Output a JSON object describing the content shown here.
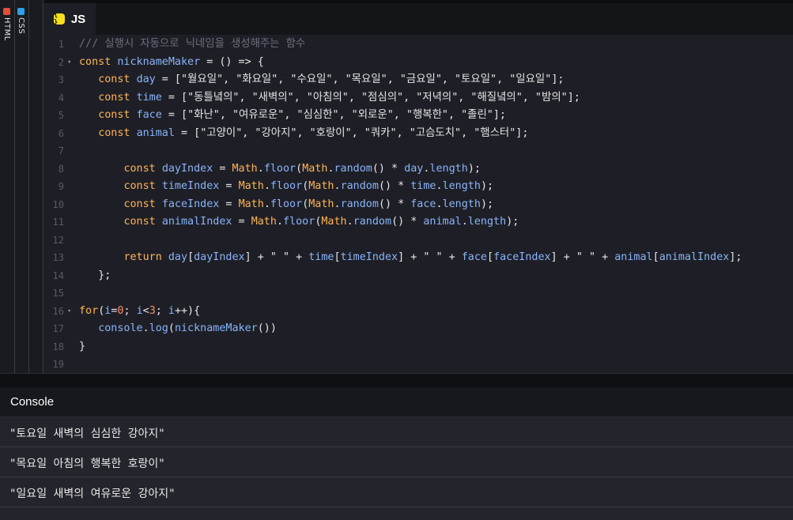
{
  "side_tabs": [
    {
      "label": "HTML",
      "icon": "html-badge-icon"
    },
    {
      "label": "CSS",
      "icon": "css-badge-icon"
    }
  ],
  "editor": {
    "active_tab": "JS",
    "lines": [
      {
        "n": "1",
        "fold": ""
      },
      {
        "n": "2",
        "fold": "▾"
      },
      {
        "n": "3",
        "fold": ""
      },
      {
        "n": "4",
        "fold": ""
      },
      {
        "n": "5",
        "fold": ""
      },
      {
        "n": "6",
        "fold": ""
      },
      {
        "n": "7",
        "fold": ""
      },
      {
        "n": "8",
        "fold": ""
      },
      {
        "n": "9",
        "fold": ""
      },
      {
        "n": "10",
        "fold": ""
      },
      {
        "n": "11",
        "fold": ""
      },
      {
        "n": "12",
        "fold": ""
      },
      {
        "n": "13",
        "fold": ""
      },
      {
        "n": "14",
        "fold": ""
      },
      {
        "n": "15",
        "fold": ""
      },
      {
        "n": "16",
        "fold": "▾"
      },
      {
        "n": "17",
        "fold": ""
      },
      {
        "n": "18",
        "fold": ""
      },
      {
        "n": "19",
        "fold": ""
      }
    ],
    "code": [
      [
        [
          "c",
          "/// 실행시 자동으로 닉네임을 생성해주는 함수"
        ]
      ],
      [
        [
          "k",
          "const "
        ],
        [
          "v",
          "nicknameMaker"
        ],
        [
          "p",
          " = () => {"
        ]
      ],
      [
        [
          "p",
          "   "
        ],
        [
          "k",
          "const "
        ],
        [
          "v",
          "day"
        ],
        [
          "p",
          " = ["
        ],
        [
          "s",
          "\"월요일\", \"화요일\", \"수요일\", \"목요일\", \"금요일\", \"토요일\", \"일요일\""
        ],
        [
          "p",
          "];"
        ]
      ],
      [
        [
          "p",
          "   "
        ],
        [
          "k",
          "const "
        ],
        [
          "v",
          "time"
        ],
        [
          "p",
          " = ["
        ],
        [
          "s",
          "\"동틀녘의\", \"새벽의\", \"아침의\", \"점심의\", \"저녁의\", \"해질녘의\", \"밤의\""
        ],
        [
          "p",
          "];"
        ]
      ],
      [
        [
          "p",
          "   "
        ],
        [
          "k",
          "const "
        ],
        [
          "v",
          "face"
        ],
        [
          "p",
          " = ["
        ],
        [
          "s",
          "\"화난\", \"여유로운\", \"심심한\", \"외로운\", \"행복한\", \"졸린\""
        ],
        [
          "p",
          "];"
        ]
      ],
      [
        [
          "p",
          "   "
        ],
        [
          "k",
          "const "
        ],
        [
          "v",
          "animal"
        ],
        [
          "p",
          " = ["
        ],
        [
          "s",
          "\"고양이\", \"강아지\", \"호랑이\", \"쿼카\", \"고슴도치\", \"햄스터\""
        ],
        [
          "p",
          "];"
        ]
      ],
      [],
      [
        [
          "p",
          "       "
        ],
        [
          "k",
          "const "
        ],
        [
          "v",
          "dayIndex"
        ],
        [
          "p",
          " = "
        ],
        [
          "f",
          "Math"
        ],
        [
          "p",
          "."
        ],
        [
          "m",
          "floor"
        ],
        [
          "p",
          "("
        ],
        [
          "f",
          "Math"
        ],
        [
          "p",
          "."
        ],
        [
          "m",
          "random"
        ],
        [
          "p",
          "() * "
        ],
        [
          "v",
          "day"
        ],
        [
          "p",
          "."
        ],
        [
          "m",
          "length"
        ],
        [
          "p",
          ");"
        ]
      ],
      [
        [
          "p",
          "       "
        ],
        [
          "k",
          "const "
        ],
        [
          "v",
          "timeIndex"
        ],
        [
          "p",
          " = "
        ],
        [
          "f",
          "Math"
        ],
        [
          "p",
          "."
        ],
        [
          "m",
          "floor"
        ],
        [
          "p",
          "("
        ],
        [
          "f",
          "Math"
        ],
        [
          "p",
          "."
        ],
        [
          "m",
          "random"
        ],
        [
          "p",
          "() * "
        ],
        [
          "v",
          "time"
        ],
        [
          "p",
          "."
        ],
        [
          "m",
          "length"
        ],
        [
          "p",
          ");"
        ]
      ],
      [
        [
          "p",
          "       "
        ],
        [
          "k",
          "const "
        ],
        [
          "v",
          "faceIndex"
        ],
        [
          "p",
          " = "
        ],
        [
          "f",
          "Math"
        ],
        [
          "p",
          "."
        ],
        [
          "m",
          "floor"
        ],
        [
          "p",
          "("
        ],
        [
          "f",
          "Math"
        ],
        [
          "p",
          "."
        ],
        [
          "m",
          "random"
        ],
        [
          "p",
          "() * "
        ],
        [
          "v",
          "face"
        ],
        [
          "p",
          "."
        ],
        [
          "m",
          "length"
        ],
        [
          "p",
          ");"
        ]
      ],
      [
        [
          "p",
          "       "
        ],
        [
          "k",
          "const "
        ],
        [
          "v",
          "animalIndex"
        ],
        [
          "p",
          " = "
        ],
        [
          "f",
          "Math"
        ],
        [
          "p",
          "."
        ],
        [
          "m",
          "floor"
        ],
        [
          "p",
          "("
        ],
        [
          "f",
          "Math"
        ],
        [
          "p",
          "."
        ],
        [
          "m",
          "random"
        ],
        [
          "p",
          "() * "
        ],
        [
          "v",
          "animal"
        ],
        [
          "p",
          "."
        ],
        [
          "m",
          "length"
        ],
        [
          "p",
          ");"
        ]
      ],
      [],
      [
        [
          "p",
          "       "
        ],
        [
          "k",
          "return "
        ],
        [
          "v",
          "day"
        ],
        [
          "p",
          "["
        ],
        [
          "v",
          "dayIndex"
        ],
        [
          "p",
          "] + \" \" + "
        ],
        [
          "v",
          "time"
        ],
        [
          "p",
          "["
        ],
        [
          "v",
          "timeIndex"
        ],
        [
          "p",
          "] + \" \" + "
        ],
        [
          "v",
          "face"
        ],
        [
          "p",
          "["
        ],
        [
          "v",
          "faceIndex"
        ],
        [
          "p",
          "] + \" \" + "
        ],
        [
          "v",
          "animal"
        ],
        [
          "p",
          "["
        ],
        [
          "v",
          "animalIndex"
        ],
        [
          "p",
          "];"
        ]
      ],
      [
        [
          "p",
          "   };"
        ]
      ],
      [],
      [
        [
          "k",
          "for"
        ],
        [
          "p",
          "("
        ],
        [
          "v",
          "i"
        ],
        [
          "p",
          "="
        ],
        [
          "n",
          "0"
        ],
        [
          "p",
          "; "
        ],
        [
          "v",
          "i"
        ],
        [
          "p",
          "<"
        ],
        [
          "n",
          "3"
        ],
        [
          "p",
          "; "
        ],
        [
          "v",
          "i"
        ],
        [
          "p",
          "++){"
        ]
      ],
      [
        [
          "p",
          "   "
        ],
        [
          "v",
          "console"
        ],
        [
          "p",
          "."
        ],
        [
          "m",
          "log"
        ],
        [
          "p",
          "("
        ],
        [
          "v",
          "nicknameMaker"
        ],
        [
          "p",
          "())"
        ]
      ],
      [
        [
          "p",
          "}"
        ]
      ],
      []
    ]
  },
  "console": {
    "title": "Console",
    "logs": [
      "\"토요일 새벽의 심심한 강아지\"",
      "\"목요일 아침의 행복한 호랑이\"",
      "\"일요일 새벽의 여유로운 강아지\""
    ]
  }
}
